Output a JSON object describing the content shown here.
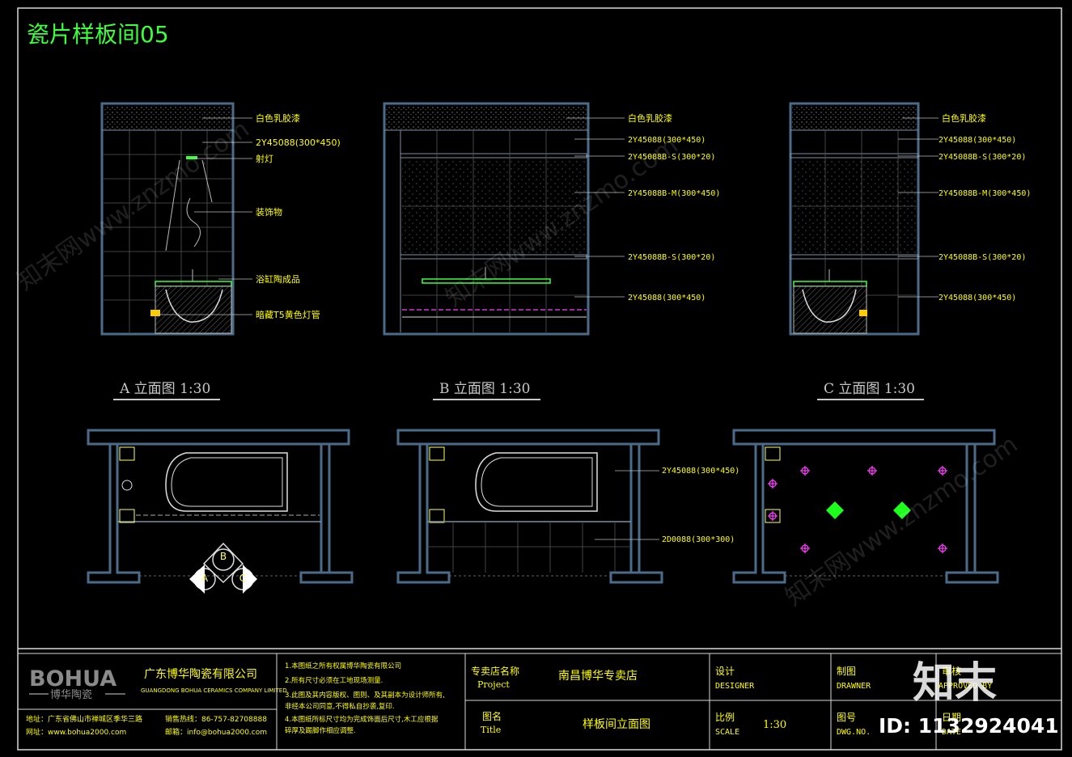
{
  "title": "瓷片样板间05",
  "elevation_a": {
    "caption": "A 立面图 1:30",
    "labels": [
      "白色乳胶漆",
      "2Y45088(300*450)",
      "射灯",
      "装饰物",
      "浴缸陶成品",
      "暗藏T5黄色灯管"
    ]
  },
  "elevation_b": {
    "caption": "B 立面图 1:30",
    "labels": [
      "白色乳胶漆",
      "2Y45088(300*450)",
      "2Y45088B-S(300*20)",
      "2Y45088B-M(300*450)",
      "2Y45088B-S(300*20)",
      "2Y45088(300*450)"
    ]
  },
  "elevation_c": {
    "caption": "C 立面图 1:30",
    "labels": [
      "白色乳胶漆",
      "2Y45088(300*450)",
      "2Y45088B-S(300*20)",
      "2Y45088B-M(300*450)",
      "2Y45088B-S(300*20)",
      "2Y45088(300*450)"
    ]
  },
  "plan_b": {
    "labels": [
      "2Y45088(300*450)",
      "2D0088(300*300)"
    ]
  },
  "index_marks": [
    "B",
    "A",
    "C"
  ],
  "title_block": {
    "logo": "BOHUA",
    "logo_sub": "博华陶瓷",
    "company": "广东博华陶瓷有限公司",
    "company_en": "GUANGDONG BOHUA CERAMICS COMPANY LIMITED",
    "address": "地址：广东省佛山市禅城区季华三路",
    "hotline": "销售热线：86-757-82708888",
    "website": "网址：www.bohua2000.com",
    "email": "邮箱：info@bohua2000.com",
    "notes": [
      "1.本图纸之所有权属博华陶瓷有限公司",
      "2.所有尺寸必须在工地现场测量.",
      "3.此图及其内容版权、图则、及其副本为设计师所有,",
      "非经本公司同意,不得私自抄袭,复印.",
      "4.本图纸所标尺寸均为完成饰面后尺寸,木工应根据",
      "碎厚及踢脚作相应调整."
    ],
    "project_label": "专卖店名称",
    "project_label_en": "Project",
    "project_value": "南昌博华专卖店",
    "title_label": "图名",
    "title_label_en": "Title",
    "title_value": "样板间立面图",
    "designer_label": "设计",
    "designer_label_en": "DESIGNER",
    "scale_label": "比例",
    "scale_label_en": "SCALE",
    "scale_value": "1:30",
    "drawn_label": "制图",
    "drawn_label_en": "DRAWNER",
    "dwgno_label": "图号",
    "dwgno_label_en": "DWG.NO.",
    "approved_label": "审核",
    "approved_label_en": "APPROVED BY",
    "date_label": "日期",
    "date_label_en": "DATE"
  },
  "watermark": {
    "brand": "知末",
    "id": "ID: 1132924041",
    "diagonal_text": "知末网www.znzmo.com"
  },
  "colors": {
    "background": "#000000",
    "wall": "#4a6b8a",
    "grid": "#7a8fa3",
    "label_yellow": "#ffff00",
    "title_green": "#3cff3c",
    "frame": "#d8d8d8",
    "accent_magenta": "#ff40ff",
    "accent_green": "#1eff1e"
  }
}
